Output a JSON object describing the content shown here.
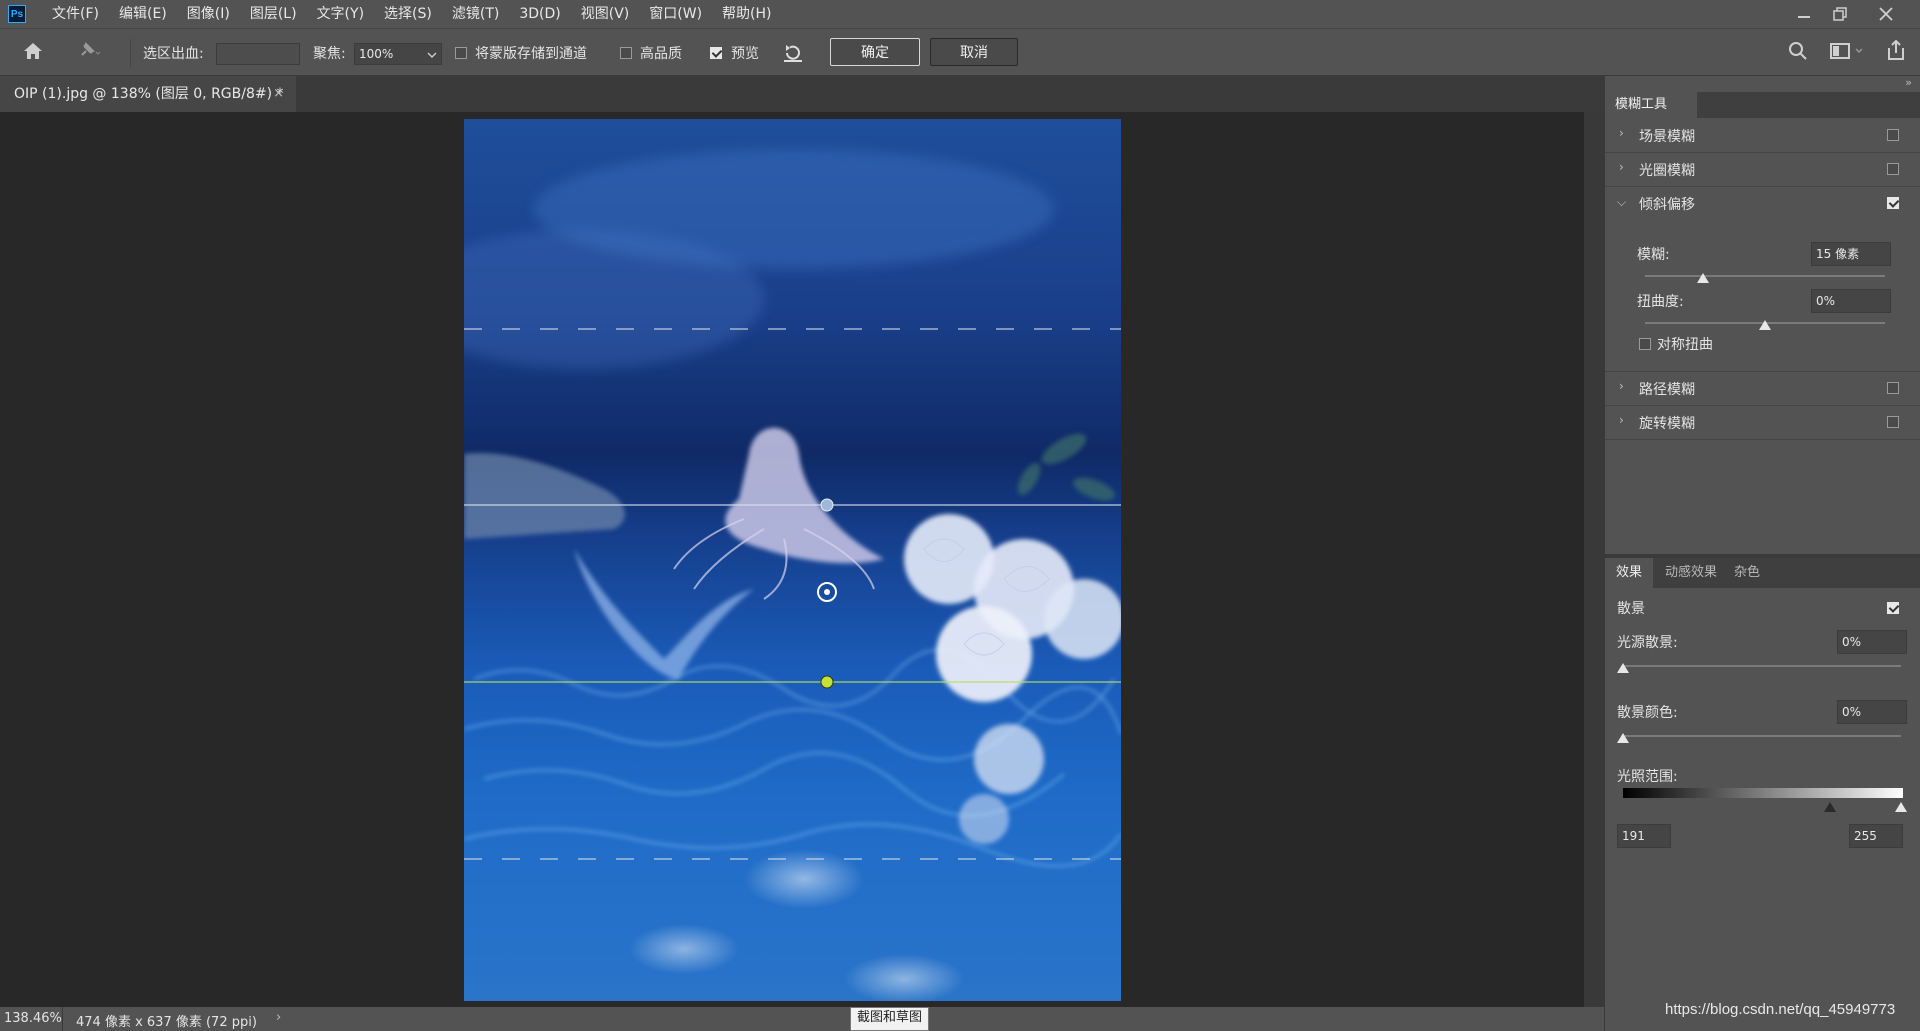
{
  "menu": {
    "logo": "Ps",
    "items": [
      "文件(F)",
      "编辑(E)",
      "图像(I)",
      "图层(L)",
      "文字(Y)",
      "选择(S)",
      "滤镜(T)",
      "3D(D)",
      "视图(V)",
      "窗口(W)",
      "帮助(H)"
    ]
  },
  "options": {
    "selection_bleed_label": "选区出血:",
    "focus_label": "聚焦:",
    "focus_value": "100%",
    "save_mask_label": "将蒙版存储到通道",
    "save_mask_checked": false,
    "high_quality_label": "高品质",
    "high_quality_checked": false,
    "preview_label": "预览",
    "preview_checked": true,
    "ok_label": "确定",
    "cancel_label": "取消"
  },
  "document": {
    "tab_title": "OIP (1).jpg @ 138% (图层 0, RGB/8#) *"
  },
  "status": {
    "zoom": "138.46%",
    "doc_info": "474 像素 x 637 像素 (72 ppi)",
    "tooltip": "截图和草图",
    "watermark": "https://blog.csdn.net/qq_45949773"
  },
  "blur_panel": {
    "title": "模糊工具",
    "sections": [
      {
        "label": "场景模糊",
        "checked": false
      },
      {
        "label": "光圈模糊",
        "checked": false
      },
      {
        "label": "倾斜偏移",
        "checked": true,
        "expanded": true
      },
      {
        "label": "路径模糊",
        "checked": false
      },
      {
        "label": "旋转模糊",
        "checked": false
      }
    ],
    "tilt": {
      "blur_label": "模糊:",
      "blur_value": "15 像素",
      "blur_level": 0.24,
      "distortion_label": "扭曲度:",
      "distortion_value": "0%",
      "distortion_level": 0.5,
      "symmetric_label": "对称扭曲",
      "symmetric_checked": false
    }
  },
  "effects_panel": {
    "tabs": [
      "效果",
      "动感效果",
      "杂色"
    ],
    "active_tab": 0,
    "bokeh_label": "散景",
    "bokeh_checked": true,
    "light_bokeh_label": "光源散景:",
    "light_bokeh_value": "0%",
    "bokeh_color_label": "散景颜色:",
    "bokeh_color_value": "0%",
    "light_range_label": "光照范围:",
    "light_range_low": "191",
    "light_range_high": "255"
  }
}
